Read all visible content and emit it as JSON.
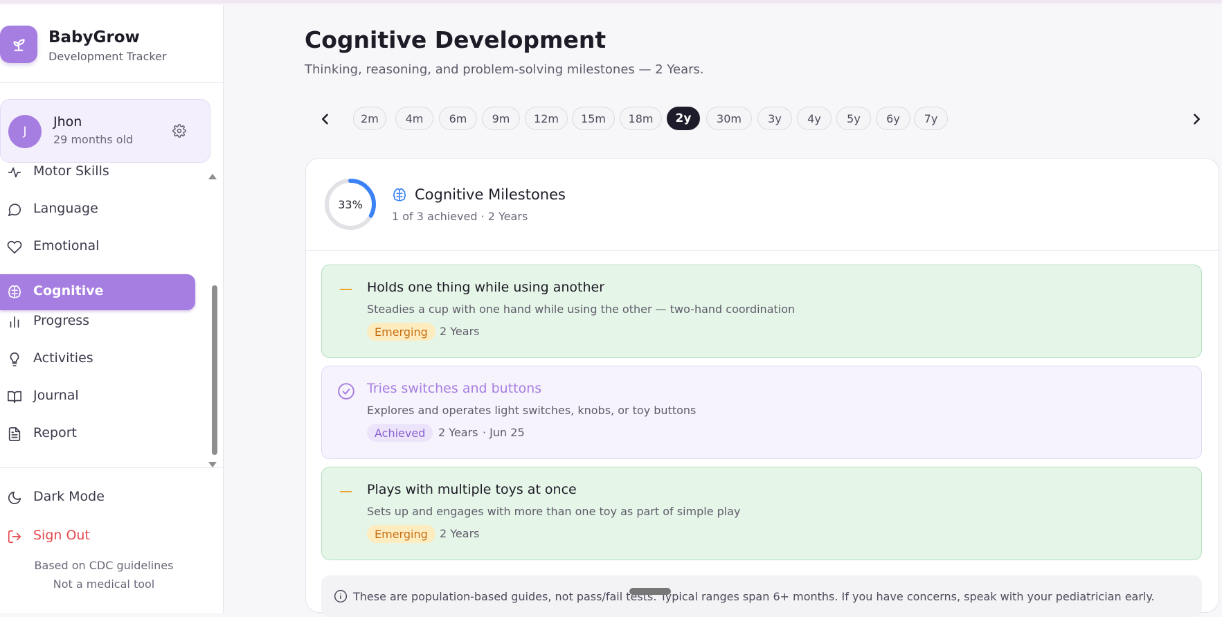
{
  "brand": {
    "name": "BabyGrow",
    "subtitle": "Development Tracker"
  },
  "profile": {
    "initial": "J",
    "name": "Jhon",
    "age": "29 months old"
  },
  "nav": {
    "items": [
      {
        "label": "Motor Skills",
        "icon": "activity-icon"
      },
      {
        "label": "Language",
        "icon": "chat-bubble-icon"
      },
      {
        "label": "Emotional",
        "icon": "heart-icon"
      },
      {
        "label": "Cognitive",
        "icon": "brain-icon",
        "active": true
      },
      {
        "label": "Progress",
        "icon": "bar-chart-icon"
      },
      {
        "label": "Activities",
        "icon": "lightbulb-icon"
      },
      {
        "label": "Journal",
        "icon": "book-icon"
      },
      {
        "label": "Report",
        "icon": "document-icon"
      }
    ]
  },
  "bottom": {
    "dark_mode": "Dark Mode",
    "sign_out": "Sign Out",
    "note1": "Based on CDC guidelines",
    "note2": "Not a medical tool"
  },
  "page": {
    "title": "Cognitive Development",
    "subtitle": "Thinking, reasoning, and problem-solving milestones — 2 Years."
  },
  "ages": {
    "options": [
      "2m",
      "4m",
      "6m",
      "9m",
      "12m",
      "15m",
      "18m",
      "2y",
      "30m",
      "3y",
      "4y",
      "5y",
      "6y",
      "7y"
    ],
    "selected": "2y"
  },
  "summary": {
    "percent": "33%",
    "percent_value": 0.33,
    "title": "Cognitive Milestones",
    "subtitle": "1 of 3 achieved · 2 Years"
  },
  "milestones": [
    {
      "title": "Holds one thing while using another",
      "description": "Steadies a cup with one hand while using the other — two-hand coordination",
      "status": "Emerging",
      "age": "2 Years",
      "date": ""
    },
    {
      "title": "Tries switches and buttons",
      "description": "Explores and operates light switches, knobs, or toy buttons",
      "status": "Achieved",
      "age": "2 Years",
      "date": "· Jun 25"
    },
    {
      "title": "Plays with multiple toys at once",
      "description": "Sets up and engages with more than one toy as part of simple play",
      "status": "Emerging",
      "age": "2 Years",
      "date": ""
    }
  ],
  "info": "These are population-based guides, not pass/fail tests. Typical ranges span 6+ months. If you have concerns, speak with your pediatrician early.",
  "colors": {
    "accent": "#a67de1",
    "emerging_bg": "#e5f5e8",
    "emerging_badge": "#fdecc0",
    "ring": "#3b82f6",
    "sign_out": "#e5484d"
  }
}
